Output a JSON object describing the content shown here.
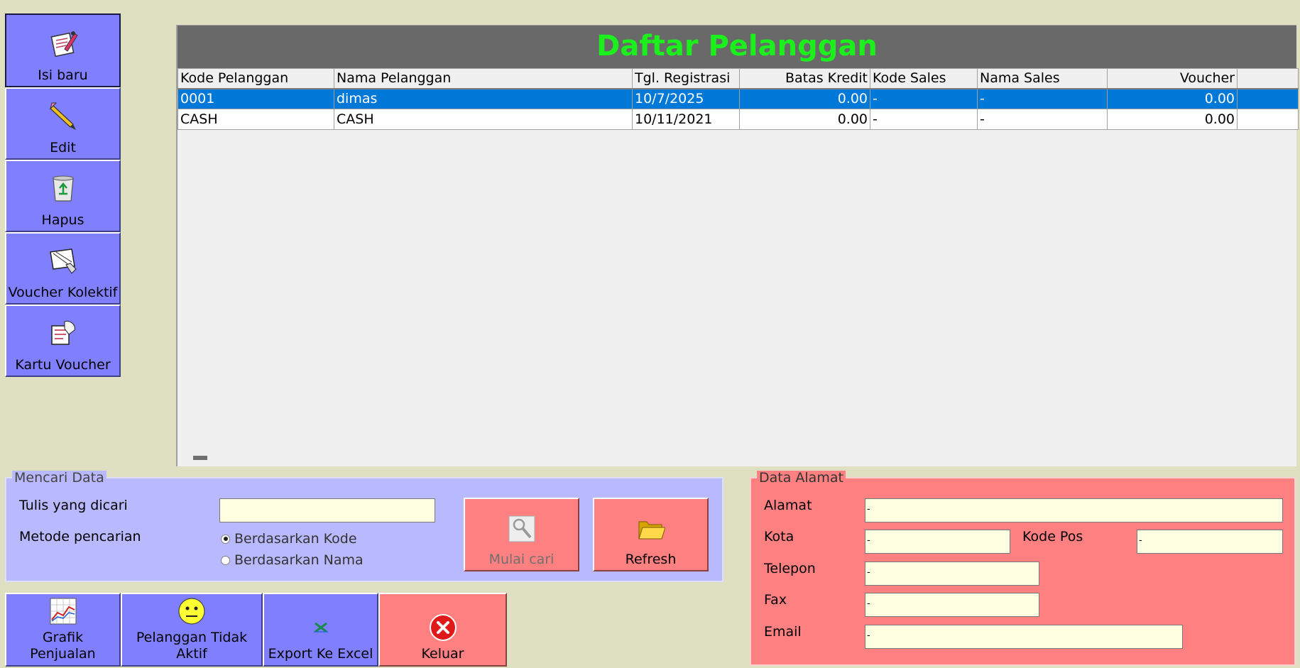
{
  "toolbar": {
    "items": [
      {
        "label": "Isi baru",
        "icon": "new-entry-icon"
      },
      {
        "label": "Edit",
        "icon": "pencil-icon"
      },
      {
        "label": "Hapus",
        "icon": "recycle-bin-icon"
      },
      {
        "label": "Voucher Kolektif",
        "icon": "voucher-collective-icon"
      },
      {
        "label": "Kartu Voucher",
        "icon": "voucher-card-icon"
      }
    ]
  },
  "grid": {
    "title": "Daftar Pelanggan",
    "columns": [
      "Kode Pelanggan",
      "Nama Pelanggan",
      "Tgl. Registrasi",
      "Batas Kredit",
      "Kode Sales",
      "Nama Sales",
      "Voucher"
    ],
    "rows": [
      [
        "0001",
        "dimas",
        "10/7/2025",
        "0.00",
        "-",
        "-",
        "0.00"
      ],
      [
        "CASH",
        "CASH",
        "10/11/2021",
        "0.00",
        "-",
        "-",
        "0.00"
      ]
    ],
    "selected_row": 0
  },
  "search": {
    "legend": "Mencari Data",
    "query_label": "Tulis yang dicari",
    "query_value": "",
    "method_label": "Metode pencarian",
    "options": [
      "Berdasarkan Kode",
      "Berdasarkan Nama"
    ],
    "selected_option": 0,
    "search_button": "Mulai cari",
    "refresh_button": "Refresh"
  },
  "address": {
    "legend": "Data Alamat",
    "alamat_label": "Alamat",
    "alamat_value": "-",
    "kota_label": "Kota",
    "kota_value": "-",
    "kodepos_label": "Kode Pos",
    "kodepos_value": "-",
    "telepon_label": "Telepon",
    "telepon_value": "-",
    "fax_label": "Fax",
    "fax_value": "-",
    "email_label": "Email",
    "email_value": "-"
  },
  "bottom": {
    "grafik": "Grafik Penjualan",
    "tidak_aktif": "Pelanggan Tidak Aktif",
    "export": "Export Ke Excel",
    "keluar": "Keluar"
  },
  "colors": {
    "background": "#dfdfc1",
    "blue_button": "#8080ff",
    "red_button": "#ff8080",
    "title_green": "#1cf01c",
    "selection": "#0078d7"
  }
}
